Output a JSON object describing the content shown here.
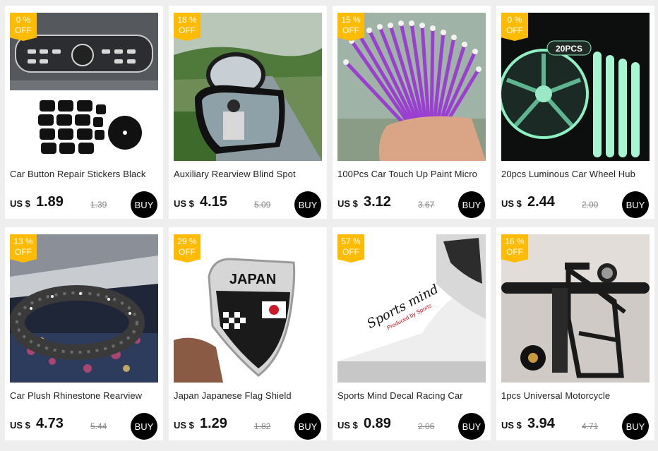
{
  "currency_label": "US $",
  "buy_label": "BUY",
  "off_label": "OFF",
  "products": [
    {
      "discount": "0  %",
      "title": "Car Button Repair Stickers Black",
      "price": "1.89",
      "old_price": "1.39",
      "image_icon": "car-radio-sticker-image"
    },
    {
      "discount": "18  %",
      "title": "Auxiliary Rearview Blind Spot",
      "price": "4.15",
      "old_price": "5.09",
      "image_icon": "side-mirror-image"
    },
    {
      "discount": "15  %",
      "title": "100Pcs Car Touch Up Paint Micro",
      "price": "3.12",
      "old_price": "3.67",
      "image_icon": "micro-brushes-image"
    },
    {
      "discount": "0  %",
      "title": "20pcs Luminous Car Wheel Hub",
      "price": "2.44",
      "old_price": "2.00",
      "image_icon": "luminous-wheel-image"
    },
    {
      "discount": "13  %",
      "title": "Car Plush Rhinestone Rearview",
      "price": "4.73",
      "old_price": "5.44",
      "image_icon": "rearview-cover-image"
    },
    {
      "discount": "29  %",
      "title": "Japan Japanese Flag Shield",
      "price": "1.29",
      "old_price": "1.82",
      "image_icon": "japan-badge-image"
    },
    {
      "discount": "57  %",
      "title": "Sports Mind Decal Racing Car",
      "price": "0.89",
      "old_price": "2.06",
      "image_icon": "sports-decal-image"
    },
    {
      "discount": "16  %",
      "title": "1pcs Universal Motorcycle",
      "price": "3.94",
      "old_price": "4.71",
      "image_icon": "bottle-holder-image"
    }
  ],
  "image_text": {
    "wheel_tag": "20PCS",
    "badge_word": "JAPAN",
    "decal_main": "Sports mind",
    "decal_sub": "Produced by Sports"
  }
}
